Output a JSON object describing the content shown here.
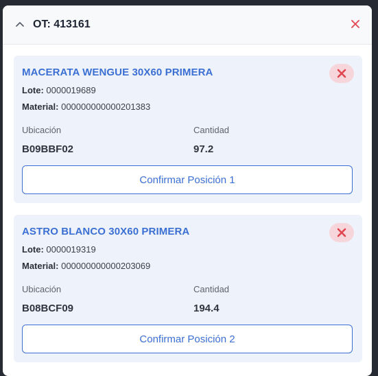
{
  "header": {
    "title": "OT: 413161",
    "collapse_icon": "chevron-up-icon",
    "close_icon": "close-icon",
    "close_color": "#e0454f"
  },
  "labels": {
    "lote": "Lote:",
    "material": "Material:",
    "ubicacion": "Ubicación",
    "cantidad": "Cantidad"
  },
  "items": [
    {
      "title": "MACERATA WENGUE 30X60 PRIMERA",
      "lote": "0000019689",
      "material": "000000000000201383",
      "ubicacion": "B09BBF02",
      "cantidad": "97.2",
      "confirm_label": "Confirmar Posición 1"
    },
    {
      "title": "ASTRO BLANCO 30X60 PRIMERA",
      "lote": "0000019319",
      "material": "000000000000203069",
      "ubicacion": "B08BCF09",
      "cantidad": "194.4",
      "confirm_label": "Confirmar Posición 2"
    }
  ],
  "colors": {
    "accent": "#3b6fd3",
    "card_bg": "#eef3fb",
    "remove_bg": "#f7d6db",
    "remove_icon": "#e0454f"
  }
}
